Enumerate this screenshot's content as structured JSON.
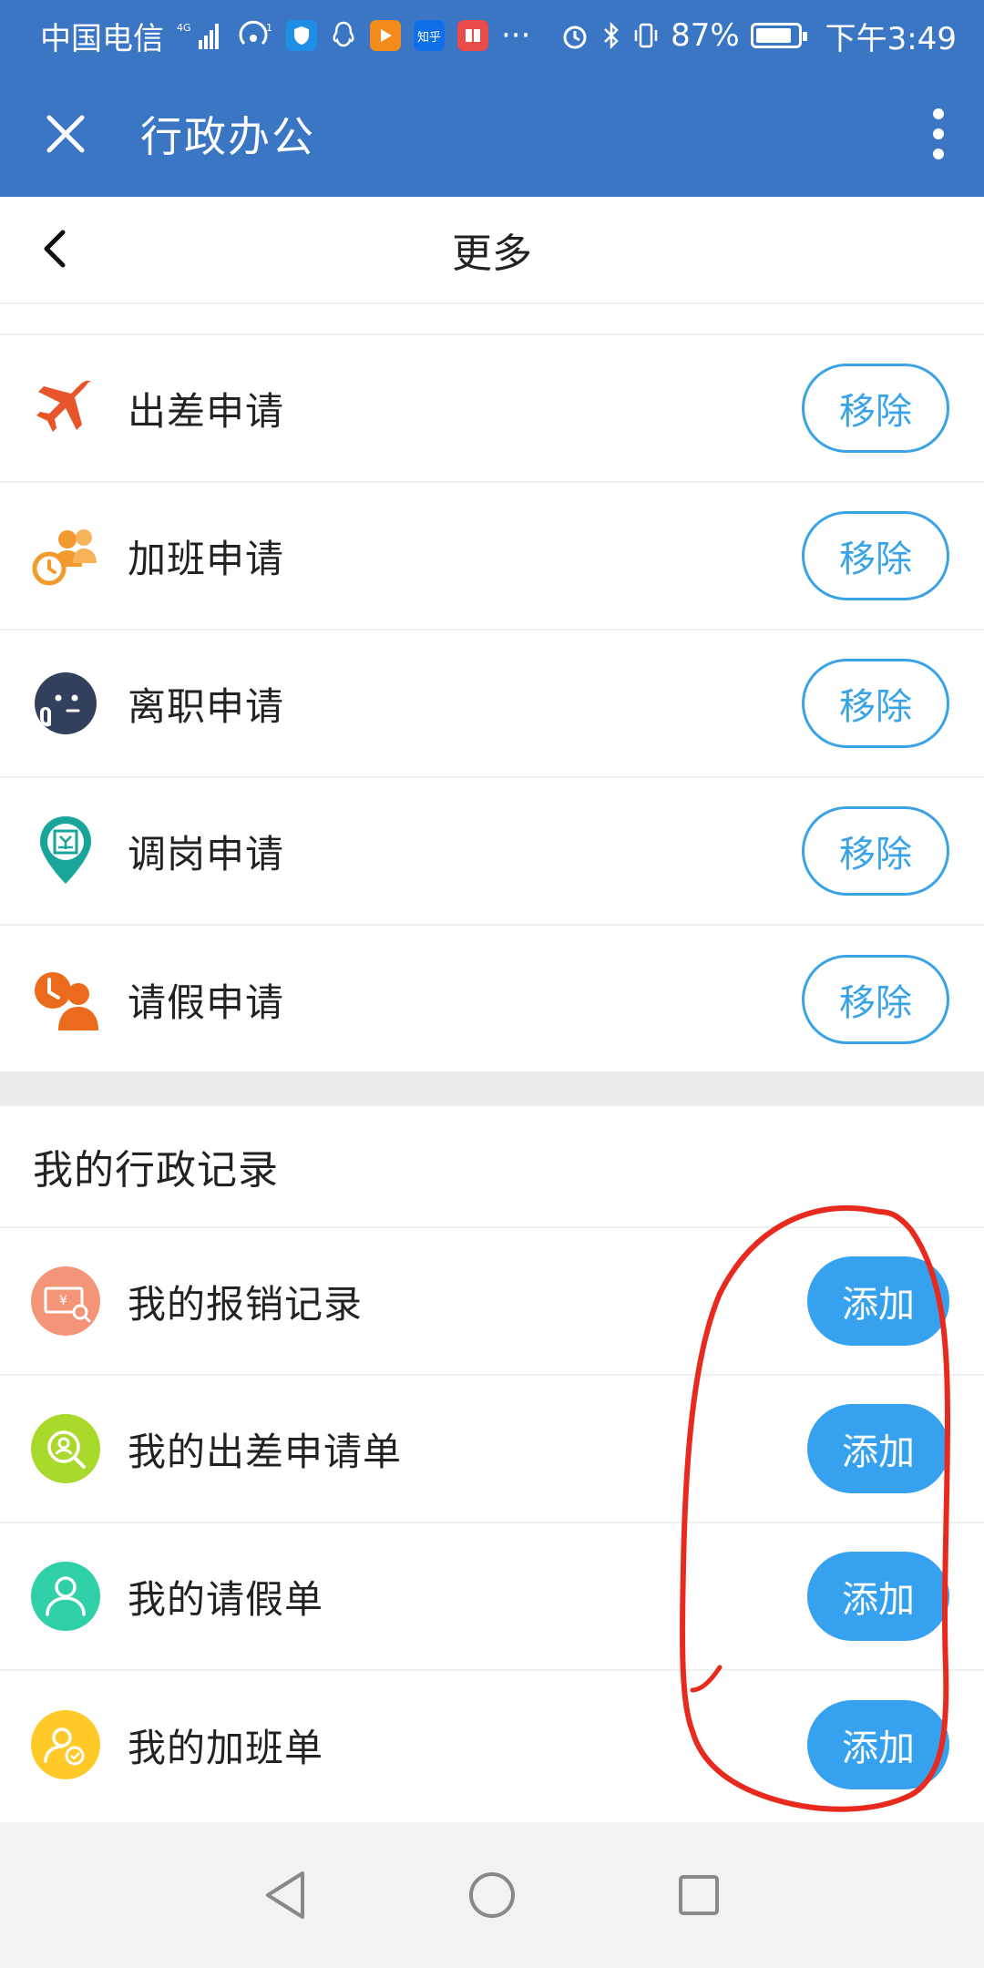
{
  "status_bar": {
    "carrier": "中国电信",
    "network": "4G",
    "battery_text": "87%",
    "battery_level": 0.87,
    "time": "下午3:49",
    "app_badges": [
      {
        "name": "shield-app-icon",
        "text": "",
        "color": "#1f8fe6"
      },
      {
        "name": "video-app-icon",
        "text": "",
        "color": "#f28b1c"
      },
      {
        "name": "zhihu-app-icon",
        "text": "知乎",
        "color": "#0e6fe8"
      },
      {
        "name": "book-app-icon",
        "text": "",
        "color": "#e94a4a"
      }
    ],
    "more": "···"
  },
  "app_bar": {
    "title": "行政办公",
    "close_icon": "close-icon",
    "more_icon": "more-vert-icon"
  },
  "sub_header": {
    "title": "更多",
    "back_icon": "chevron-left-icon"
  },
  "applications": [
    {
      "label": "出差申请",
      "button": "移除",
      "icon": "airplane-icon",
      "color": "#e8552b"
    },
    {
      "label": "加班申请",
      "button": "移除",
      "icon": "overtime-people-clock-icon",
      "color": "#f29a2e"
    },
    {
      "label": "离职申请",
      "button": "移除",
      "icon": "resign-face-icon",
      "color": "#33405c"
    },
    {
      "label": "调岗申请",
      "button": "移除",
      "icon": "position-pin-icon",
      "color": "#1aa59a"
    },
    {
      "label": "请假申请",
      "button": "移除",
      "icon": "leave-person-clock-icon",
      "color": "#ec6a1c"
    }
  ],
  "records_section": {
    "title": "我的行政记录",
    "items": [
      {
        "label": "我的报销记录",
        "button": "添加",
        "icon": "reimbursement-receipt-icon",
        "color": "#f4957a"
      },
      {
        "label": "我的出差申请单",
        "button": "添加",
        "icon": "trip-search-icon",
        "color": "#a8d92b"
      },
      {
        "label": "我的请假单",
        "button": "添加",
        "icon": "leave-user-icon",
        "color": "#2fcfa8"
      },
      {
        "label": "我的加班单",
        "button": "添加",
        "icon": "overtime-user-icon",
        "color": "#ffc928"
      }
    ]
  },
  "annotation": {
    "shape": "hand-drawn-ellipse",
    "color": "#e8291e"
  },
  "nav_bar": {
    "back": "nav-back-icon",
    "home": "nav-home-icon",
    "recents": "nav-recents-icon"
  },
  "colors": {
    "primary": "#3a76c4",
    "accent": "#36a1ee",
    "outline": "#39a3e6"
  }
}
